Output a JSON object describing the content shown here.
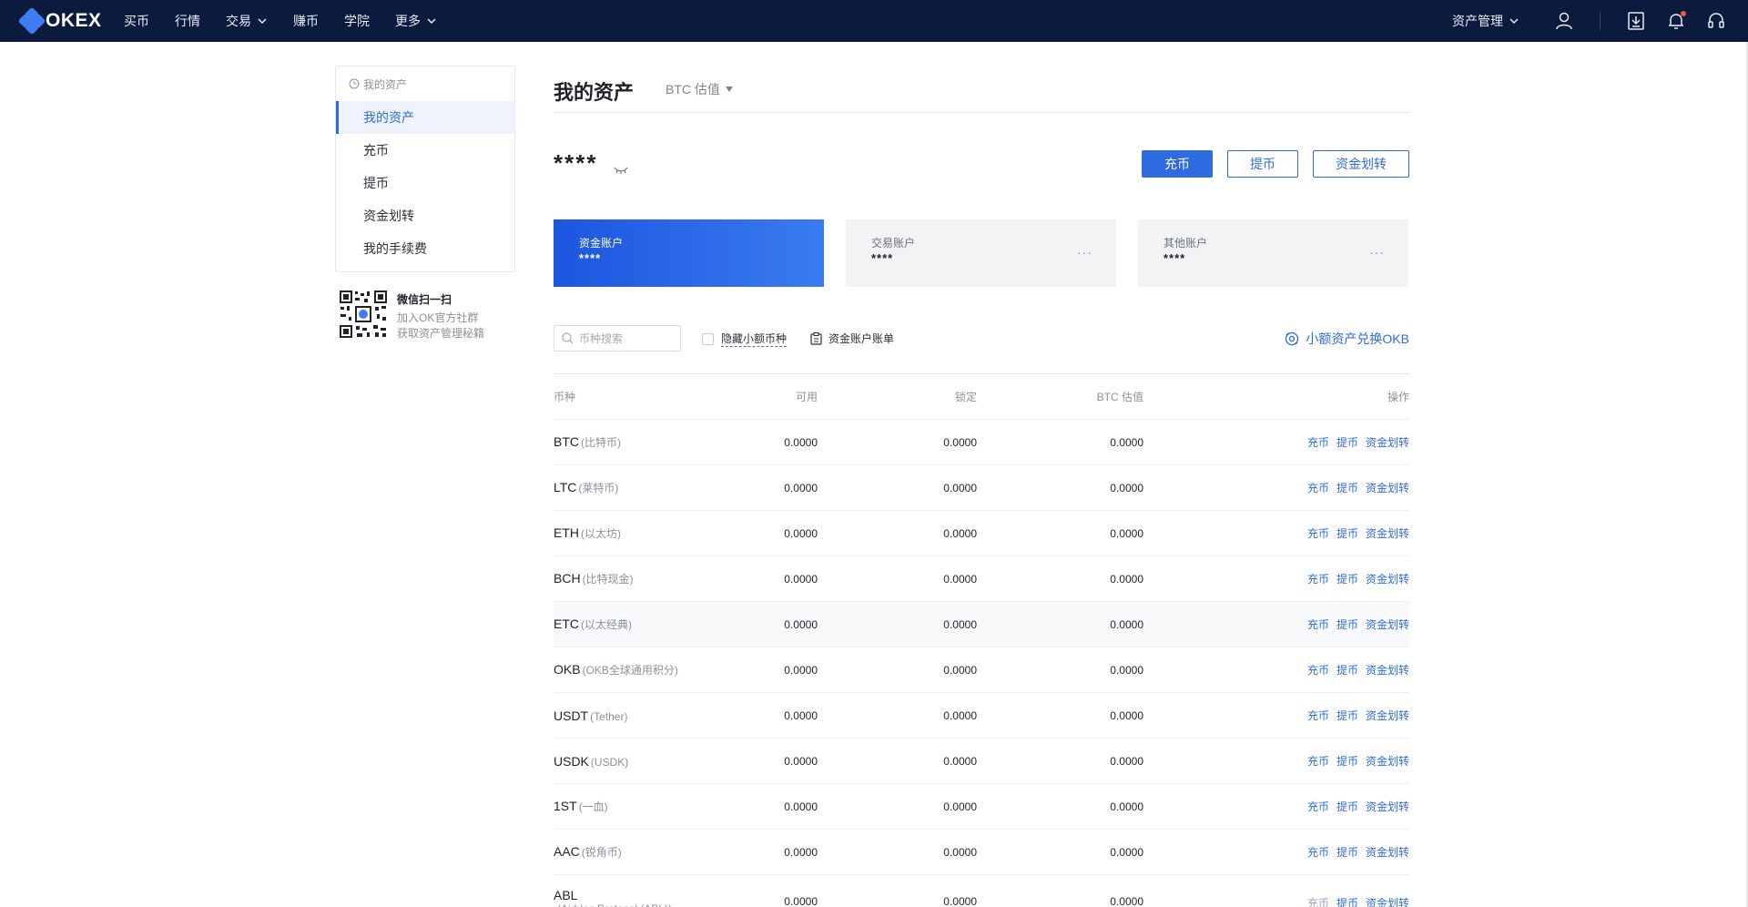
{
  "nav": {
    "brand": "OKEX",
    "items": [
      {
        "label": "买币",
        "dropdown": false
      },
      {
        "label": "行情",
        "dropdown": false
      },
      {
        "label": "交易",
        "dropdown": true
      },
      {
        "label": "赚币",
        "dropdown": false
      },
      {
        "label": "学院",
        "dropdown": false
      },
      {
        "label": "更多",
        "dropdown": true
      }
    ],
    "asset_management": "资产管理",
    "icons": [
      "user-icon",
      "download-icon",
      "bell-icon",
      "headset-icon"
    ]
  },
  "sidebar": {
    "header": "我的资产",
    "items": [
      {
        "label": "我的资产",
        "active": true
      },
      {
        "label": "充币",
        "active": false
      },
      {
        "label": "提币",
        "active": false
      },
      {
        "label": "资金划转",
        "active": false
      },
      {
        "label": "我的手续费",
        "active": false
      }
    ]
  },
  "promo": {
    "title": "微信扫一扫",
    "line1": "加入OK官方社群",
    "line2": "获取资产管理秘籍"
  },
  "main": {
    "title": "我的资产",
    "valuation": "BTC 估值",
    "total_masked": "****",
    "buttons": {
      "deposit": "充币",
      "withdraw": "提币",
      "transfer": "资金划转"
    }
  },
  "accounts": [
    {
      "label": "资金账户",
      "value": "****",
      "active": true
    },
    {
      "label": "交易账户",
      "value": "****",
      "active": false,
      "more": "···"
    },
    {
      "label": "其他账户",
      "value": "****",
      "active": false,
      "more": "···"
    }
  ],
  "filters": {
    "search_placeholder": "币种搜索",
    "hide_small": "隐藏小额币种",
    "bill": "资金账户账单",
    "exchange": "小额资产兑换OKB"
  },
  "table": {
    "headers": {
      "coin": "币种",
      "available": "可用",
      "locked": "锁定",
      "btc": "BTC 估值",
      "ops": "操作"
    },
    "op_labels": {
      "deposit": "充币",
      "withdraw": "提币",
      "transfer": "资金划转"
    },
    "rows": [
      {
        "symbol": "BTC",
        "name": "(比特币)",
        "available": "0.0000",
        "locked": "0.0000",
        "btc": "0.0000"
      },
      {
        "symbol": "LTC",
        "name": "(莱特币)",
        "available": "0.0000",
        "locked": "0.0000",
        "btc": "0.0000"
      },
      {
        "symbol": "ETH",
        "name": "(以太坊)",
        "available": "0.0000",
        "locked": "0.0000",
        "btc": "0.0000"
      },
      {
        "symbol": "BCH",
        "name": "(比特现金)",
        "available": "0.0000",
        "locked": "0.0000",
        "btc": "0.0000"
      },
      {
        "symbol": "ETC",
        "name": "(以太经典)",
        "available": "0.0000",
        "locked": "0.0000",
        "btc": "0.0000"
      },
      {
        "symbol": "OKB",
        "name": "(OKB全球通用积分)",
        "available": "0.0000",
        "locked": "0.0000",
        "btc": "0.0000"
      },
      {
        "symbol": "USDT",
        "name": "(Tether)",
        "available": "0.0000",
        "locked": "0.0000",
        "btc": "0.0000"
      },
      {
        "symbol": "USDK",
        "name": "(USDK)",
        "available": "0.0000",
        "locked": "0.0000",
        "btc": "0.0000"
      },
      {
        "symbol": "1ST",
        "name": "(一血)",
        "available": "0.0000",
        "locked": "0.0000",
        "btc": "0.0000"
      },
      {
        "symbol": "AAC",
        "name": "(锐角币)",
        "available": "0.0000",
        "locked": "0.0000",
        "btc": "0.0000"
      },
      {
        "symbol": "ABL",
        "name": "(Airbloc Protocol (ABL))",
        "available": "0.0000",
        "locked": "0.0000",
        "btc": "0.0000"
      }
    ]
  },
  "colors": {
    "nav_bg": "#0b1a3d",
    "accent": "#2f6be0"
  }
}
